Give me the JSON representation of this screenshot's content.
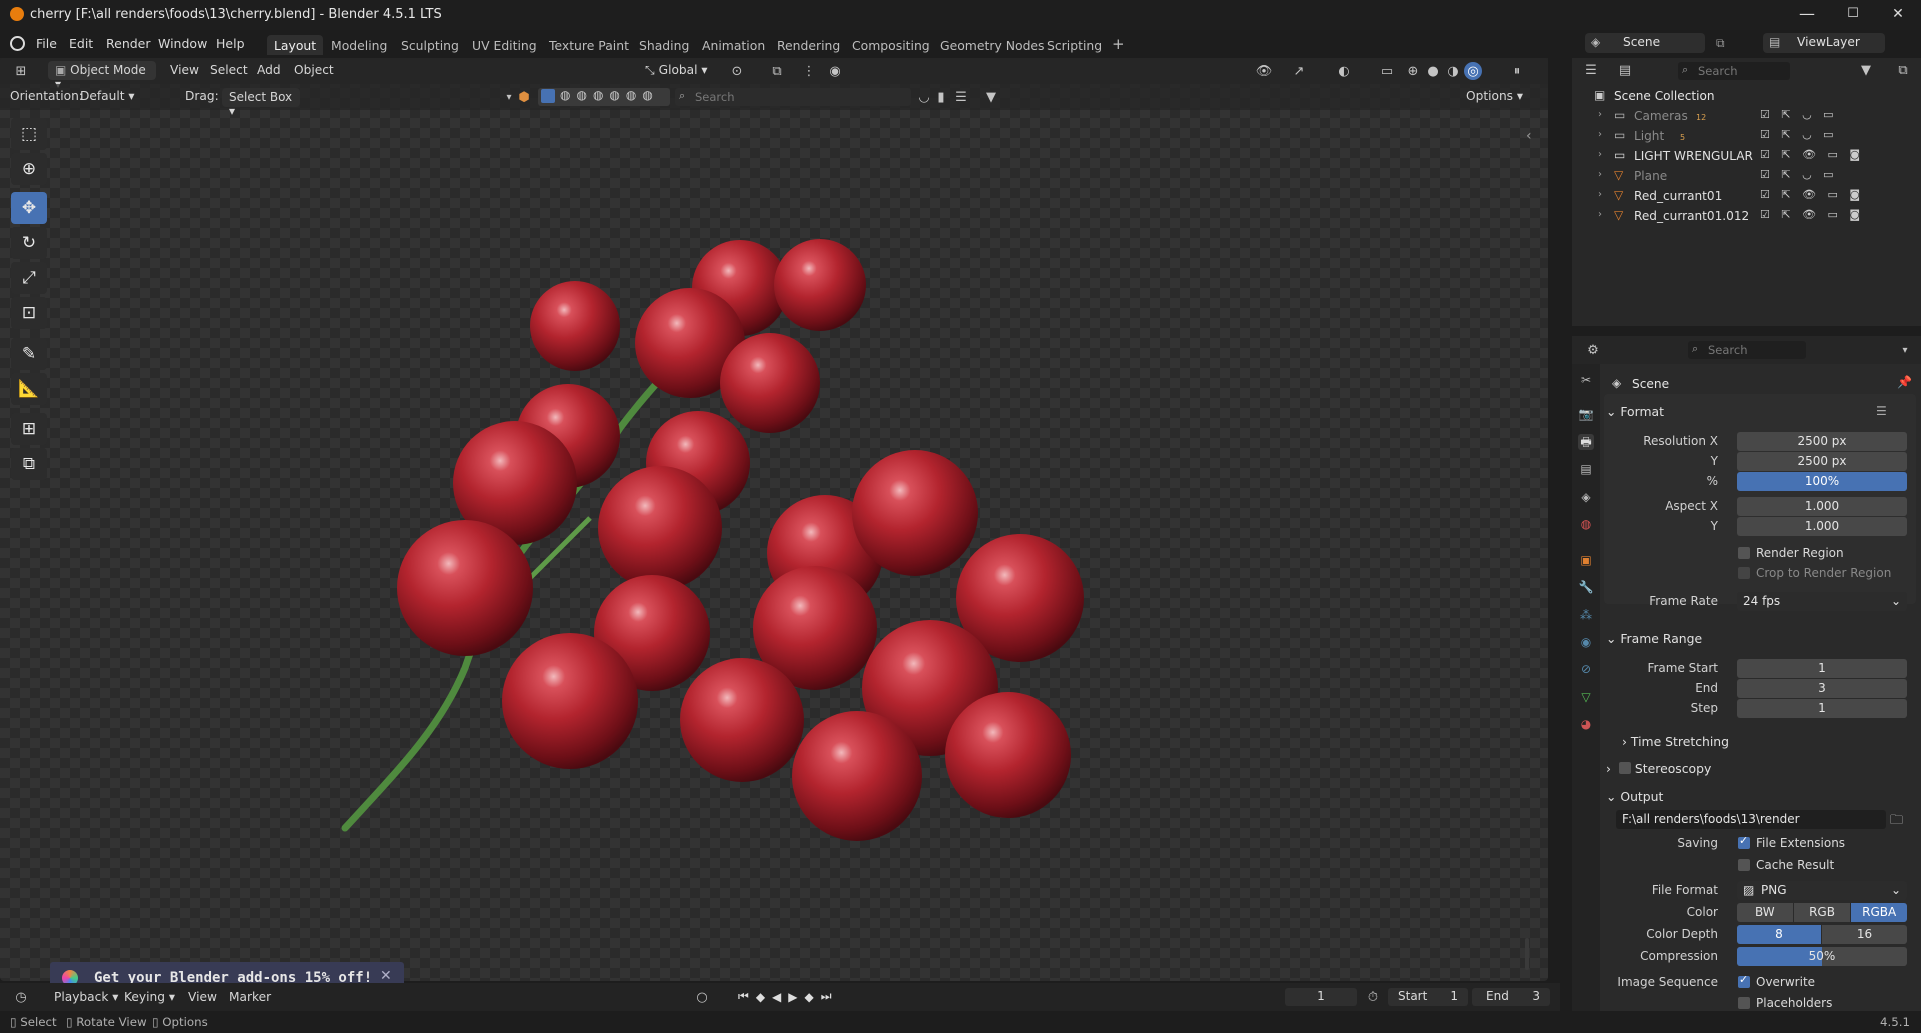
{
  "window": {
    "title": "cherry [F:\\all renders\\foods\\13\\cherry.blend] - Blender 4.5.1 LTS",
    "min": "—",
    "max": "☐",
    "close": "✕"
  },
  "menus": [
    "File",
    "Edit",
    "Render",
    "Window",
    "Help"
  ],
  "workspaces": [
    "Layout",
    "Modeling",
    "Sculpting",
    "UV Editing",
    "Texture Paint",
    "Shading",
    "Animation",
    "Rendering",
    "Compositing",
    "Geometry Nodes",
    "Scripting"
  ],
  "workspace_add": "+",
  "scene_selector": {
    "scene": "Scene",
    "view_layer": "ViewLayer"
  },
  "viewport_header": {
    "mode": "Object Mode",
    "menus": [
      "View",
      "Select",
      "Add",
      "Object"
    ],
    "transform": "Global"
  },
  "tool_settings": {
    "orientation_label": "Orientation:",
    "orientation": "Default",
    "drag_label": "Drag:",
    "drag": "Select Box",
    "search_placeholder": "Search",
    "options": "Options"
  },
  "toolbar": [
    "select-box",
    "cursor",
    "move",
    "rotate",
    "scale",
    "transform",
    "annotate",
    "measure",
    "add-cube",
    "add-primitive"
  ],
  "promo": {
    "text": "Get your Blender add-ons 15% off!",
    "close": "✕"
  },
  "outliner": {
    "search_placeholder": "Search",
    "root": "Scene Collection",
    "items": [
      {
        "name": "Cameras",
        "badge": "12",
        "dim": true
      },
      {
        "name": "Light",
        "badge": "5",
        "dim": true
      },
      {
        "name": "LIGHT WRENGULAR",
        "badge": "",
        "dim": false
      },
      {
        "name": "Plane",
        "badge": "",
        "dim": true
      },
      {
        "name": "Red_currant01",
        "badge": "",
        "dim": false
      },
      {
        "name": "Red_currant01.012",
        "badge": "",
        "dim": false
      }
    ]
  },
  "properties": {
    "search_placeholder": "Search",
    "context": "Scene",
    "format": {
      "title": "Format",
      "resolution_x_label": "Resolution X",
      "resolution_x": "2500 px",
      "resolution_y_label": "Y",
      "resolution_y": "2500 px",
      "percent_label": "%",
      "percent": "100%",
      "aspect_x_label": "Aspect X",
      "aspect_x": "1.000",
      "aspect_y_label": "Y",
      "aspect_y": "1.000",
      "render_region": "Render Region",
      "crop_region": "Crop to Render Region",
      "frame_rate_label": "Frame Rate",
      "frame_rate": "24 fps"
    },
    "frame_range": {
      "title": "Frame Range",
      "start_label": "Frame Start",
      "start": "1",
      "end_label": "End",
      "end": "3",
      "step_label": "Step",
      "step": "1"
    },
    "time_stretching": "Time Stretching",
    "stereoscopy": "Stereoscopy",
    "output": {
      "title": "Output",
      "path": "F:\\all renders\\foods\\13\\render",
      "saving_label": "Saving",
      "file_extensions": "File Extensions",
      "cache_result": "Cache Result",
      "file_format_label": "File Format",
      "file_format": "PNG",
      "color_label": "Color",
      "color_options": [
        "BW",
        "RGB",
        "RGBA"
      ],
      "color_selected": "RGBA",
      "depth_label": "Color Depth",
      "depth_options": [
        "8",
        "16"
      ],
      "depth_selected": "8",
      "compression_label": "Compression",
      "compression": "50%",
      "compression_value": 0.5,
      "image_sequence_label": "Image Sequence",
      "overwrite": "Overwrite",
      "placeholders": "Placeholders"
    }
  },
  "timeline": {
    "menus": [
      "Playback",
      "Keying",
      "View",
      "Marker"
    ],
    "current_frame": "1",
    "start_label": "Start",
    "start": "1",
    "end_label": "End",
    "end": "3"
  },
  "statusbar": {
    "select": "Select",
    "rotate": "Rotate View",
    "options": "Options",
    "version": "4.5.1"
  },
  "colors": {
    "accent": "#4772b3",
    "berry": "#b3242e",
    "stem": "#4f8a3e"
  }
}
